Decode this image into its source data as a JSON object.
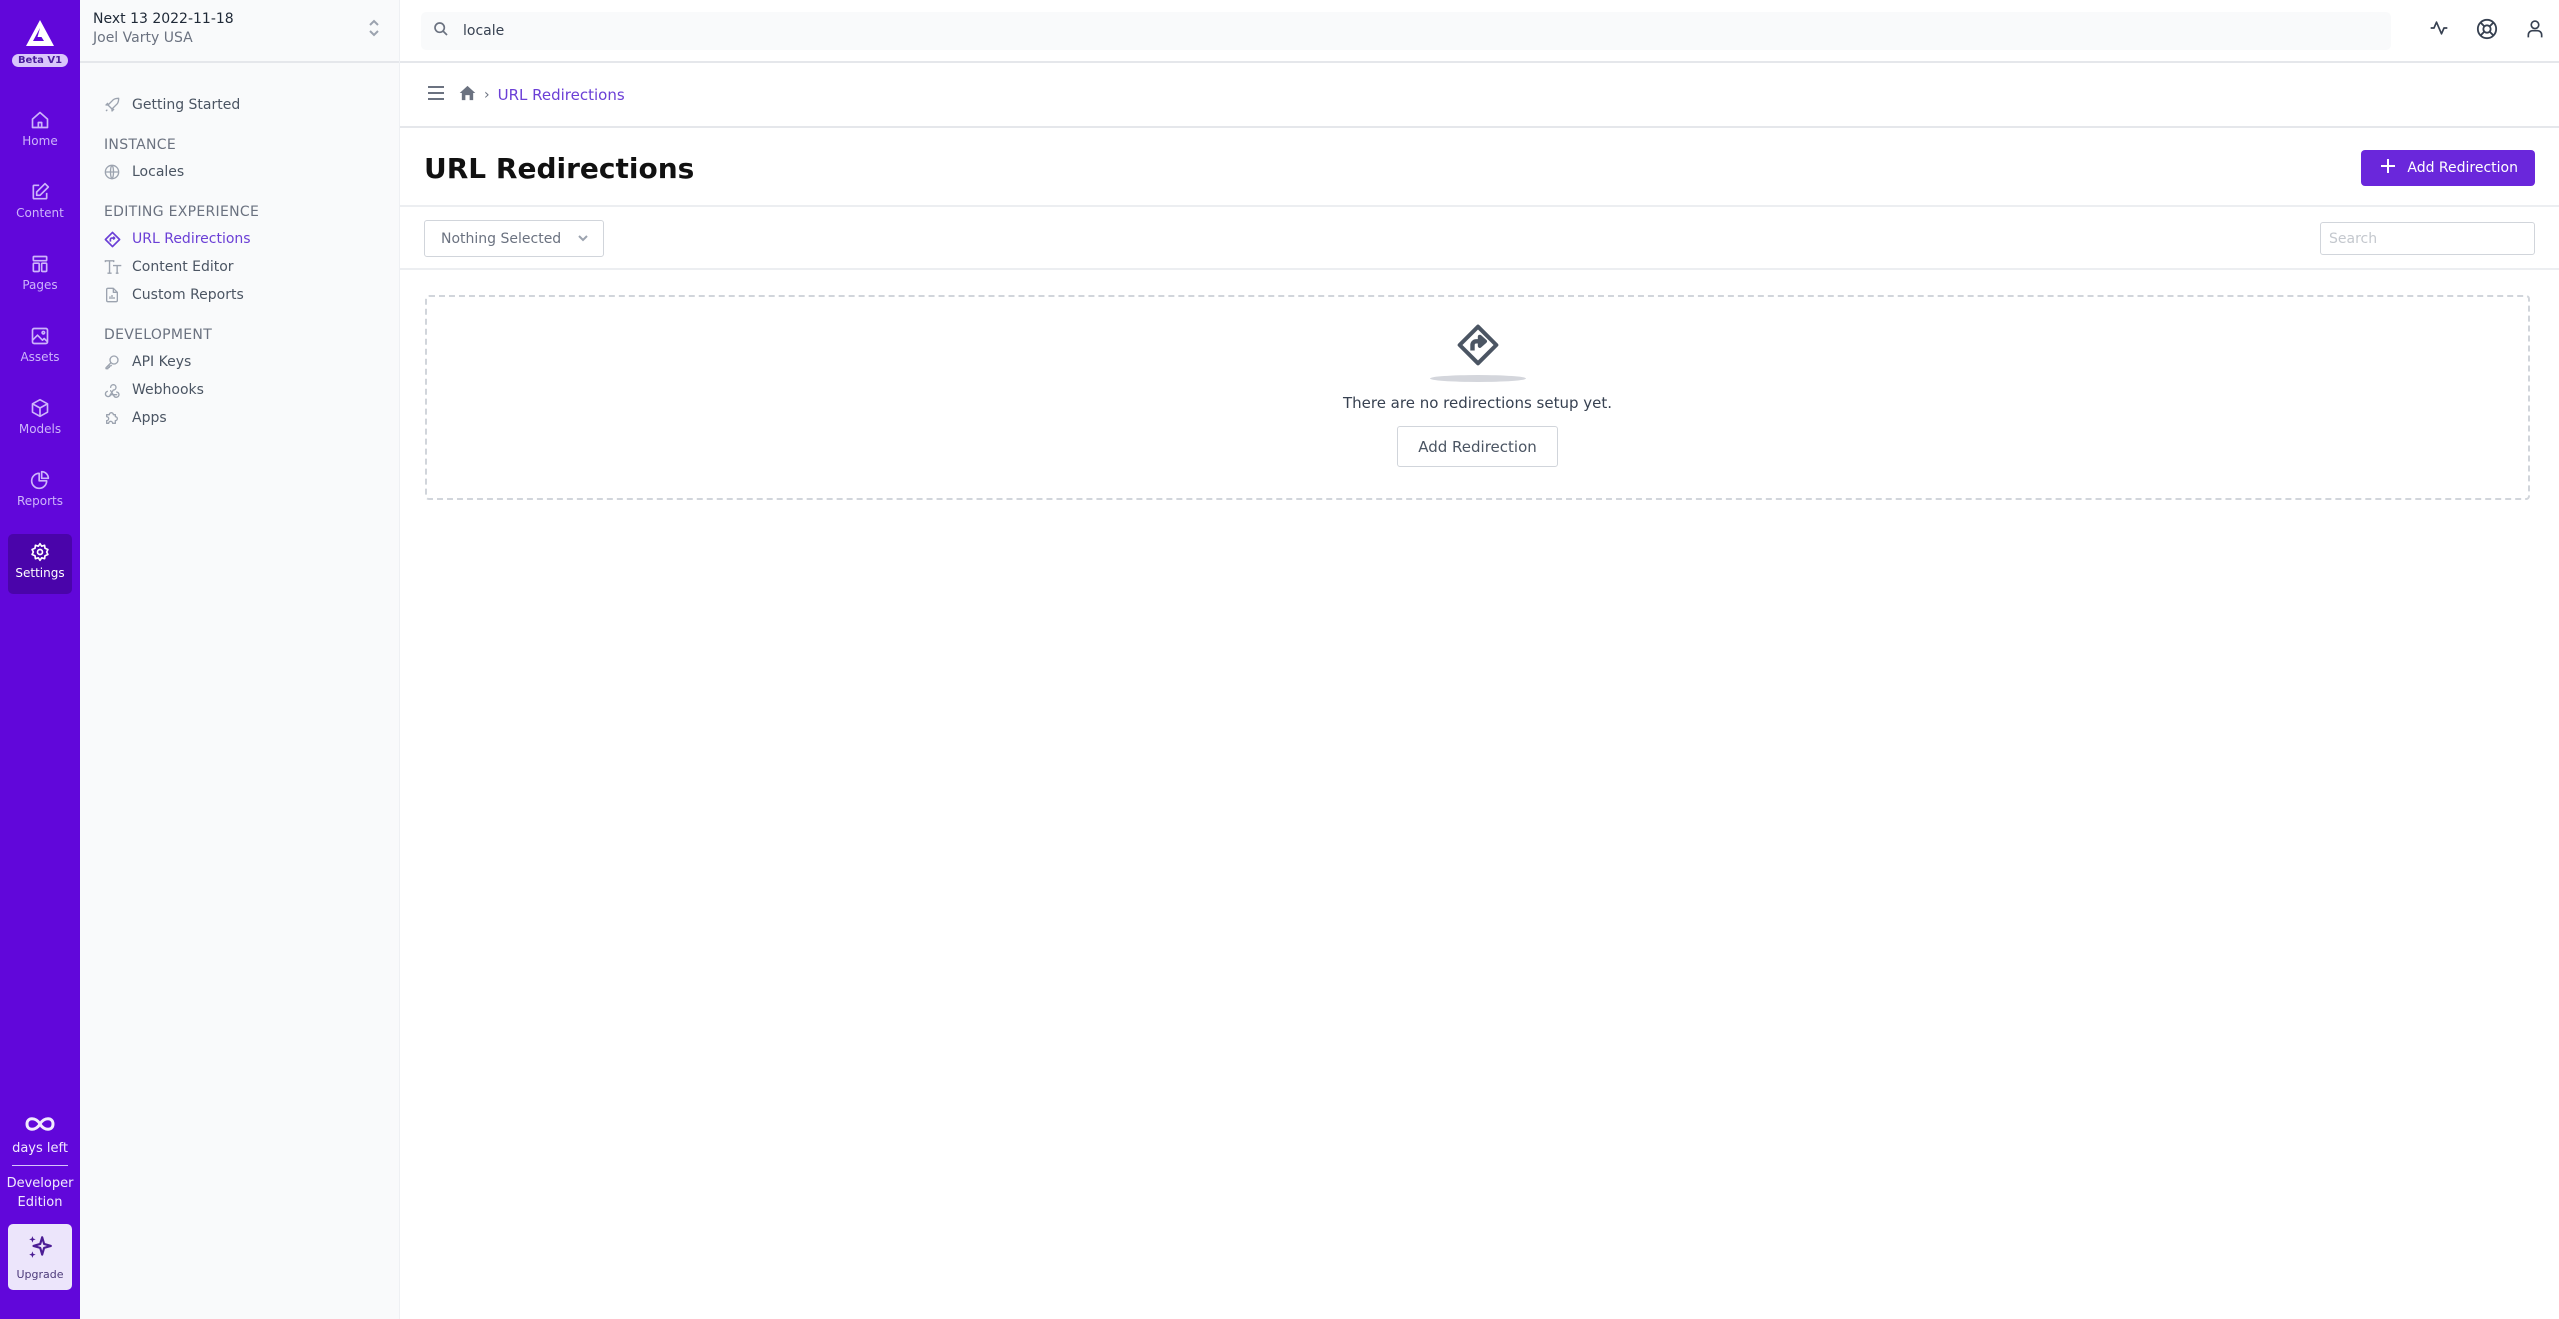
{
  "rail": {
    "logo_badge": "Beta V1",
    "items": [
      {
        "label": "Home",
        "icon": "home-icon"
      },
      {
        "label": "Content",
        "icon": "edit-icon"
      },
      {
        "label": "Pages",
        "icon": "layout-icon"
      },
      {
        "label": "Assets",
        "icon": "image-icon"
      },
      {
        "label": "Models",
        "icon": "cube-icon"
      },
      {
        "label": "Reports",
        "icon": "pie-chart-icon"
      },
      {
        "label": "Settings",
        "icon": "gear-icon",
        "active": true
      }
    ],
    "days_left_value": "∞",
    "days_left_label": "days left",
    "edition_line1": "Developer",
    "edition_line2": "Edition",
    "upgrade_label": "Upgrade"
  },
  "instance": {
    "name": "Next 13 2022-11-18",
    "owner": "Joel Varty USA"
  },
  "sidebar": {
    "getting_started": "Getting Started",
    "groups": [
      {
        "title": "INSTANCE",
        "items": [
          {
            "label": "Locales",
            "icon": "globe-icon"
          }
        ]
      },
      {
        "title": "EDITING EXPERIENCE",
        "items": [
          {
            "label": "URL Redirections",
            "icon": "redirect-icon",
            "active": true
          },
          {
            "label": "Content Editor",
            "icon": "text-size-icon"
          },
          {
            "label": "Custom Reports",
            "icon": "report-file-icon"
          }
        ]
      },
      {
        "title": "DEVELOPMENT",
        "items": [
          {
            "label": "API Keys",
            "icon": "key-icon"
          },
          {
            "label": "Webhooks",
            "icon": "webhook-icon"
          },
          {
            "label": "Apps",
            "icon": "puzzle-icon"
          }
        ]
      }
    ]
  },
  "header": {
    "search_value": "locale",
    "icons": [
      "activity-icon",
      "help-lifebuoy-icon",
      "user-icon"
    ]
  },
  "breadcrumb": {
    "separator": "›",
    "current": "URL Redirections"
  },
  "page": {
    "title": "URL Redirections",
    "add_button": "Add Redirection"
  },
  "filters": {
    "select_value": "Nothing Selected",
    "search_placeholder": "Search",
    "search_value": ""
  },
  "empty_state": {
    "message": "There are no redirections setup yet.",
    "button": "Add Redirection"
  },
  "colors": {
    "rail_bg": "#6107da",
    "accent": "#6a27db",
    "active_link": "#6b3fd6"
  }
}
